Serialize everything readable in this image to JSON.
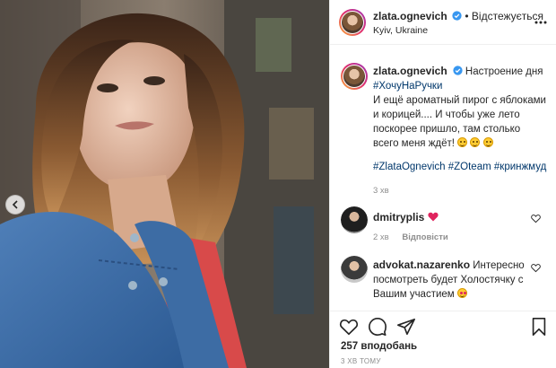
{
  "post": {
    "username": "zlata.ognevich",
    "follow_label": "Відстежується",
    "follow_sep": "•",
    "location": "Kyiv, Ukraine"
  },
  "caption": {
    "username": "zlata.ognevich",
    "line1": "Настроение дня",
    "hashtag1": "#ХочуНаРучки",
    "body": "И ещё ароматный пирог с яблоками и корицей.... И чтобы уже лето поскорее пришло, там столько всего меня ждёт!",
    "hashtags2": [
      "#ZlataOgnevich",
      "#ZOteam",
      "#кринжмуд"
    ],
    "time": "3 хв"
  },
  "comments": [
    {
      "username": "dmitryplis",
      "text": "",
      "time": "2 хв",
      "reply_label": "Відповісти"
    },
    {
      "username": "advokat.nazarenko",
      "text": "Интересно посмотреть будет Холостячку с Вашим участием"
    }
  ],
  "footer": {
    "likes": "257 вподобань",
    "time_ago": "3 хв тому"
  },
  "icons": {
    "verified": "verified-badge-icon",
    "more": "more-options-icon",
    "like": "heart-icon",
    "comment": "comment-bubble-icon",
    "share": "paper-plane-icon",
    "save": "bookmark-icon",
    "prev": "chevron-left-icon"
  },
  "colors": {
    "hashtag": "#00376b",
    "verified": "#3897f0",
    "heart_red": "#ed4956",
    "muted": "#8e8e8e",
    "border": "#efefef"
  }
}
